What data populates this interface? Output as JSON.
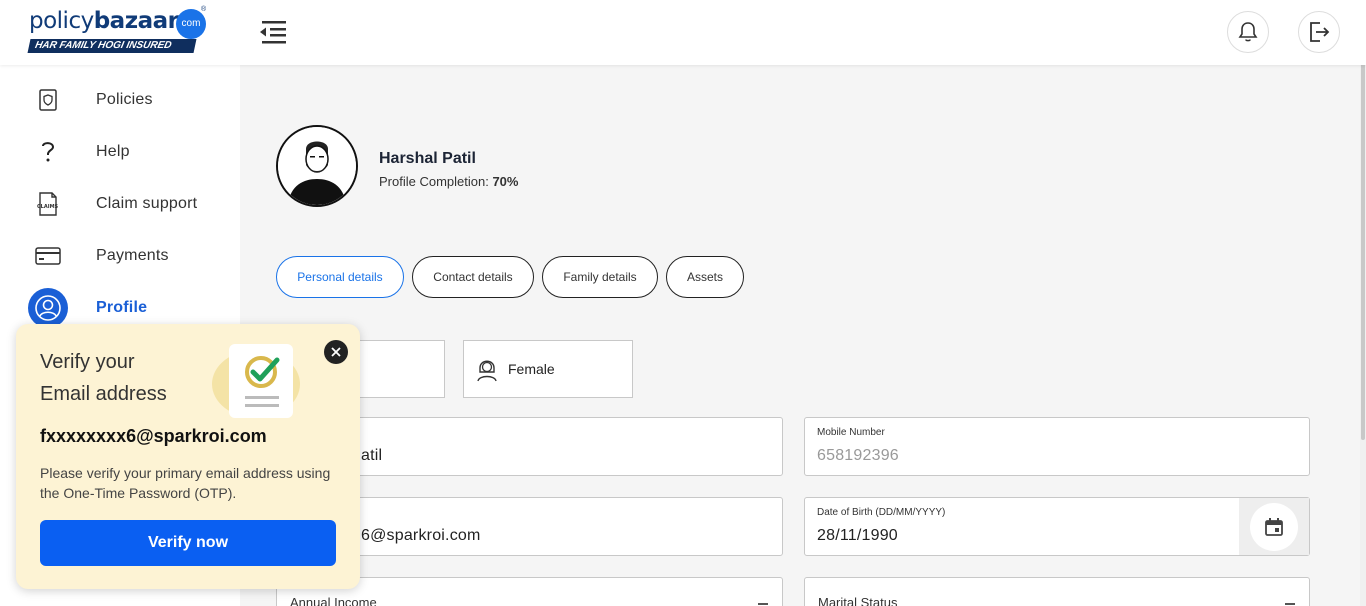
{
  "brand": {
    "logo_word1": "policy",
    "logo_word2": "bazaar",
    "logo_com": "com",
    "logo_reg": "®",
    "tagline": "HAR FAMILY HOGI INSURED"
  },
  "sidebar": {
    "items": [
      {
        "label": "Policies",
        "icon": "shield-document-icon"
      },
      {
        "label": "Help",
        "icon": "question-mark-icon"
      },
      {
        "label": "Claim support",
        "icon": "claims-document-icon"
      },
      {
        "label": "Payments",
        "icon": "card-icon"
      },
      {
        "label": "Profile",
        "icon": "user-icon",
        "active": true
      }
    ]
  },
  "profile": {
    "name": "Harshal Patil",
    "completion_label": "Profile Completion:",
    "completion_value": "70%"
  },
  "tabs": [
    {
      "label": "Personal details",
      "active": true
    },
    {
      "label": "Contact details"
    },
    {
      "label": "Family details"
    },
    {
      "label": "Assets"
    }
  ],
  "gender": {
    "female_label": "Female"
  },
  "fields": {
    "name_value": "atil",
    "mobile_label": "Mobile Number",
    "mobile_value": "658192396",
    "email_value": "6@sparkroi.com",
    "dob_label": "Date of Birth (DD/MM/YYYY)",
    "dob_value": "28/11/1990",
    "income_label": "Annual Income",
    "marital_label": "Marital Status"
  },
  "popup": {
    "title_line1": "Verify your",
    "title_line2": "Email address",
    "email": "fxxxxxxxx6@sparkroi.com",
    "description": "Please verify your primary email address using the One-Time Password (OTP).",
    "button": "Verify now"
  },
  "colors": {
    "accent": "#1a5fd6",
    "primary_button": "#0a5ff2",
    "popup_bg": "#fdf3d4",
    "brand_navy": "#103b78"
  }
}
